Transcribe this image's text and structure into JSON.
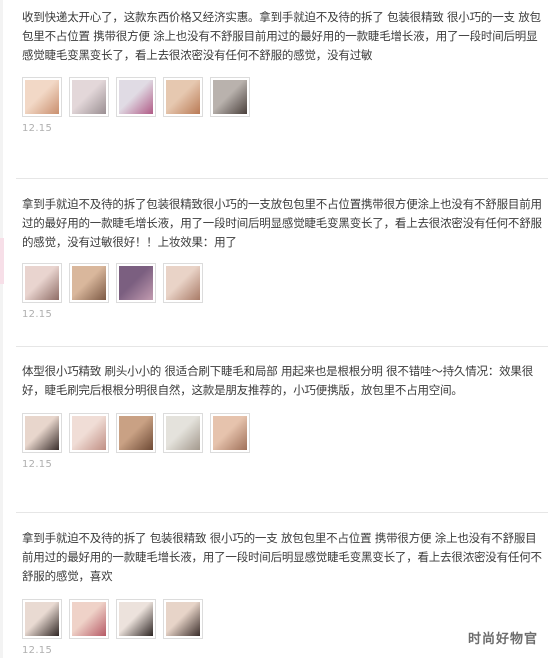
{
  "reviews": [
    {
      "text": "收到快递太开心了，这款东西价格又经济实惠。拿到手就迫不及待的拆了 包装很精致 很小巧的一支 放包包里不占位置 携带很方便 涂上也没有不舒服目前用过的最好用的一款睫毛增长液，用了一段时间后明显感觉睫毛变黑变长了，看上去很浓密没有任何不舒服的感觉，没有过敏",
      "date": "12.15",
      "photos": [
        {
          "icon": "product-photo",
          "colors": [
            "#f2d8c6",
            "#c98f6e"
          ]
        },
        {
          "icon": "package-photo",
          "colors": [
            "#e3d7d9",
            "#9a8f92"
          ]
        },
        {
          "icon": "package-photo",
          "colors": [
            "#e0dbe4",
            "#b05a86"
          ]
        },
        {
          "icon": "product-photo",
          "colors": [
            "#e6c8b0",
            "#b97a55"
          ]
        },
        {
          "icon": "product-photo",
          "colors": [
            "#b9b2ad",
            "#4a403c"
          ]
        }
      ]
    },
    {
      "text": "拿到手就迫不及待的拆了包装很精致很小巧的一支放包包里不占位置携带很方便涂上也没有不舒服目前用过的最好用的一款睫毛增长液，用了一段时间后明显感觉睫毛变黑变长了，看上去很浓密没有任何不舒服的感觉，没有过敏很好！！上妆效果：用了",
      "date": "12.15",
      "photos": [
        {
          "icon": "eye-photo",
          "colors": [
            "#e9d4cf",
            "#8f6d66"
          ]
        },
        {
          "icon": "product-photo",
          "colors": [
            "#d9b79c",
            "#7d5a45"
          ]
        },
        {
          "icon": "package-photo",
          "colors": [
            "#7b5f80",
            "#c29bb0"
          ]
        },
        {
          "icon": "product-photo",
          "colors": [
            "#e9d3c7",
            "#a97b67"
          ]
        }
      ]
    },
    {
      "text": "体型很小巧精致 刷头小小的 很适合刷下睫毛和局部 用起来也是根根分明 很不错哇～持久情况：效果很好，睫毛刷完后根根分明很自然，这款是朋友推荐的，小巧便携版，放包里不占用空间。",
      "date": "12.15",
      "photos": [
        {
          "icon": "face-photo",
          "colors": [
            "#e8d6cc",
            "#3a2e2c"
          ]
        },
        {
          "icon": "product-photo",
          "colors": [
            "#f0ddd6",
            "#c08f84"
          ]
        },
        {
          "icon": "product-photo",
          "colors": [
            "#c9a184",
            "#6e4a35"
          ]
        },
        {
          "icon": "product-photo",
          "colors": [
            "#e4e2dc",
            "#a3998d"
          ]
        },
        {
          "icon": "product-photo",
          "colors": [
            "#e6c3ad",
            "#a0715a"
          ]
        }
      ]
    },
    {
      "text": "拿到手就迫不及待的拆了 包装很精致 很小巧的一支 放包包里不占位置 携带很方便 涂上也没有不舒服目前用过的最好用的一款睫毛增长液，用了一段时间后明显感觉睫毛变黑变长了，看上去很浓密没有任何不舒服的感觉，喜欢",
      "date": "12.15",
      "photos": [
        {
          "icon": "face-photo",
          "colors": [
            "#e9dad2",
            "#2f2624"
          ]
        },
        {
          "icon": "product-photo",
          "colors": [
            "#efd2c8",
            "#b65a66"
          ]
        },
        {
          "icon": "face-photo",
          "colors": [
            "#ece2dc",
            "#2c2422"
          ]
        },
        {
          "icon": "face-photo",
          "colors": [
            "#e7d4c8",
            "#3a2d2a"
          ]
        }
      ]
    }
  ],
  "watermark": "时尚好物官"
}
